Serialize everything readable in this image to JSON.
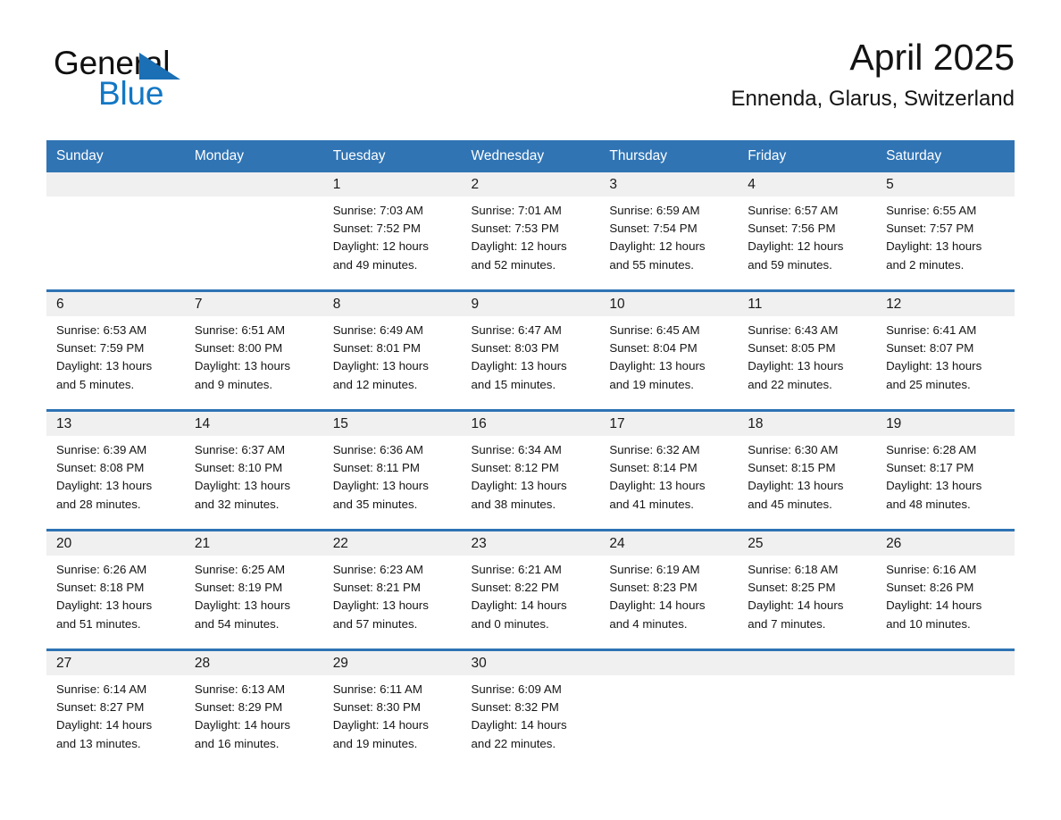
{
  "brand": {
    "line1": "General",
    "line2": "Blue",
    "triangle_color": "#1b6fb5",
    "blue_text_color": "#1277c4"
  },
  "header": {
    "title": "April 2025",
    "location": "Ennenda, Glarus, Switzerland"
  },
  "theme": {
    "header_blue": "#3074b4",
    "row_divider_blue": "#2e73b4",
    "day_band_gray": "#f0f0f0"
  },
  "weekday_headers": [
    "Sunday",
    "Monday",
    "Tuesday",
    "Wednesday",
    "Thursday",
    "Friday",
    "Saturday"
  ],
  "weeks": [
    [
      {
        "day": "",
        "sunrise": "",
        "sunset": "",
        "daylight_1": "",
        "daylight_2": ""
      },
      {
        "day": "",
        "sunrise": "",
        "sunset": "",
        "daylight_1": "",
        "daylight_2": ""
      },
      {
        "day": "1",
        "sunrise": "Sunrise: 7:03 AM",
        "sunset": "Sunset: 7:52 PM",
        "daylight_1": "Daylight: 12 hours",
        "daylight_2": "and 49 minutes."
      },
      {
        "day": "2",
        "sunrise": "Sunrise: 7:01 AM",
        "sunset": "Sunset: 7:53 PM",
        "daylight_1": "Daylight: 12 hours",
        "daylight_2": "and 52 minutes."
      },
      {
        "day": "3",
        "sunrise": "Sunrise: 6:59 AM",
        "sunset": "Sunset: 7:54 PM",
        "daylight_1": "Daylight: 12 hours",
        "daylight_2": "and 55 minutes."
      },
      {
        "day": "4",
        "sunrise": "Sunrise: 6:57 AM",
        "sunset": "Sunset: 7:56 PM",
        "daylight_1": "Daylight: 12 hours",
        "daylight_2": "and 59 minutes."
      },
      {
        "day": "5",
        "sunrise": "Sunrise: 6:55 AM",
        "sunset": "Sunset: 7:57 PM",
        "daylight_1": "Daylight: 13 hours",
        "daylight_2": "and 2 minutes."
      }
    ],
    [
      {
        "day": "6",
        "sunrise": "Sunrise: 6:53 AM",
        "sunset": "Sunset: 7:59 PM",
        "daylight_1": "Daylight: 13 hours",
        "daylight_2": "and 5 minutes."
      },
      {
        "day": "7",
        "sunrise": "Sunrise: 6:51 AM",
        "sunset": "Sunset: 8:00 PM",
        "daylight_1": "Daylight: 13 hours",
        "daylight_2": "and 9 minutes."
      },
      {
        "day": "8",
        "sunrise": "Sunrise: 6:49 AM",
        "sunset": "Sunset: 8:01 PM",
        "daylight_1": "Daylight: 13 hours",
        "daylight_2": "and 12 minutes."
      },
      {
        "day": "9",
        "sunrise": "Sunrise: 6:47 AM",
        "sunset": "Sunset: 8:03 PM",
        "daylight_1": "Daylight: 13 hours",
        "daylight_2": "and 15 minutes."
      },
      {
        "day": "10",
        "sunrise": "Sunrise: 6:45 AM",
        "sunset": "Sunset: 8:04 PM",
        "daylight_1": "Daylight: 13 hours",
        "daylight_2": "and 19 minutes."
      },
      {
        "day": "11",
        "sunrise": "Sunrise: 6:43 AM",
        "sunset": "Sunset: 8:05 PM",
        "daylight_1": "Daylight: 13 hours",
        "daylight_2": "and 22 minutes."
      },
      {
        "day": "12",
        "sunrise": "Sunrise: 6:41 AM",
        "sunset": "Sunset: 8:07 PM",
        "daylight_1": "Daylight: 13 hours",
        "daylight_2": "and 25 minutes."
      }
    ],
    [
      {
        "day": "13",
        "sunrise": "Sunrise: 6:39 AM",
        "sunset": "Sunset: 8:08 PM",
        "daylight_1": "Daylight: 13 hours",
        "daylight_2": "and 28 minutes."
      },
      {
        "day": "14",
        "sunrise": "Sunrise: 6:37 AM",
        "sunset": "Sunset: 8:10 PM",
        "daylight_1": "Daylight: 13 hours",
        "daylight_2": "and 32 minutes."
      },
      {
        "day": "15",
        "sunrise": "Sunrise: 6:36 AM",
        "sunset": "Sunset: 8:11 PM",
        "daylight_1": "Daylight: 13 hours",
        "daylight_2": "and 35 minutes."
      },
      {
        "day": "16",
        "sunrise": "Sunrise: 6:34 AM",
        "sunset": "Sunset: 8:12 PM",
        "daylight_1": "Daylight: 13 hours",
        "daylight_2": "and 38 minutes."
      },
      {
        "day": "17",
        "sunrise": "Sunrise: 6:32 AM",
        "sunset": "Sunset: 8:14 PM",
        "daylight_1": "Daylight: 13 hours",
        "daylight_2": "and 41 minutes."
      },
      {
        "day": "18",
        "sunrise": "Sunrise: 6:30 AM",
        "sunset": "Sunset: 8:15 PM",
        "daylight_1": "Daylight: 13 hours",
        "daylight_2": "and 45 minutes."
      },
      {
        "day": "19",
        "sunrise": "Sunrise: 6:28 AM",
        "sunset": "Sunset: 8:17 PM",
        "daylight_1": "Daylight: 13 hours",
        "daylight_2": "and 48 minutes."
      }
    ],
    [
      {
        "day": "20",
        "sunrise": "Sunrise: 6:26 AM",
        "sunset": "Sunset: 8:18 PM",
        "daylight_1": "Daylight: 13 hours",
        "daylight_2": "and 51 minutes."
      },
      {
        "day": "21",
        "sunrise": "Sunrise: 6:25 AM",
        "sunset": "Sunset: 8:19 PM",
        "daylight_1": "Daylight: 13 hours",
        "daylight_2": "and 54 minutes."
      },
      {
        "day": "22",
        "sunrise": "Sunrise: 6:23 AM",
        "sunset": "Sunset: 8:21 PM",
        "daylight_1": "Daylight: 13 hours",
        "daylight_2": "and 57 minutes."
      },
      {
        "day": "23",
        "sunrise": "Sunrise: 6:21 AM",
        "sunset": "Sunset: 8:22 PM",
        "daylight_1": "Daylight: 14 hours",
        "daylight_2": "and 0 minutes."
      },
      {
        "day": "24",
        "sunrise": "Sunrise: 6:19 AM",
        "sunset": "Sunset: 8:23 PM",
        "daylight_1": "Daylight: 14 hours",
        "daylight_2": "and 4 minutes."
      },
      {
        "day": "25",
        "sunrise": "Sunrise: 6:18 AM",
        "sunset": "Sunset: 8:25 PM",
        "daylight_1": "Daylight: 14 hours",
        "daylight_2": "and 7 minutes."
      },
      {
        "day": "26",
        "sunrise": "Sunrise: 6:16 AM",
        "sunset": "Sunset: 8:26 PM",
        "daylight_1": "Daylight: 14 hours",
        "daylight_2": "and 10 minutes."
      }
    ],
    [
      {
        "day": "27",
        "sunrise": "Sunrise: 6:14 AM",
        "sunset": "Sunset: 8:27 PM",
        "daylight_1": "Daylight: 14 hours",
        "daylight_2": "and 13 minutes."
      },
      {
        "day": "28",
        "sunrise": "Sunrise: 6:13 AM",
        "sunset": "Sunset: 8:29 PM",
        "daylight_1": "Daylight: 14 hours",
        "daylight_2": "and 16 minutes."
      },
      {
        "day": "29",
        "sunrise": "Sunrise: 6:11 AM",
        "sunset": "Sunset: 8:30 PM",
        "daylight_1": "Daylight: 14 hours",
        "daylight_2": "and 19 minutes."
      },
      {
        "day": "30",
        "sunrise": "Sunrise: 6:09 AM",
        "sunset": "Sunset: 8:32 PM",
        "daylight_1": "Daylight: 14 hours",
        "daylight_2": "and 22 minutes."
      },
      {
        "day": "",
        "sunrise": "",
        "sunset": "",
        "daylight_1": "",
        "daylight_2": ""
      },
      {
        "day": "",
        "sunrise": "",
        "sunset": "",
        "daylight_1": "",
        "daylight_2": ""
      },
      {
        "day": "",
        "sunrise": "",
        "sunset": "",
        "daylight_1": "",
        "daylight_2": ""
      }
    ]
  ]
}
